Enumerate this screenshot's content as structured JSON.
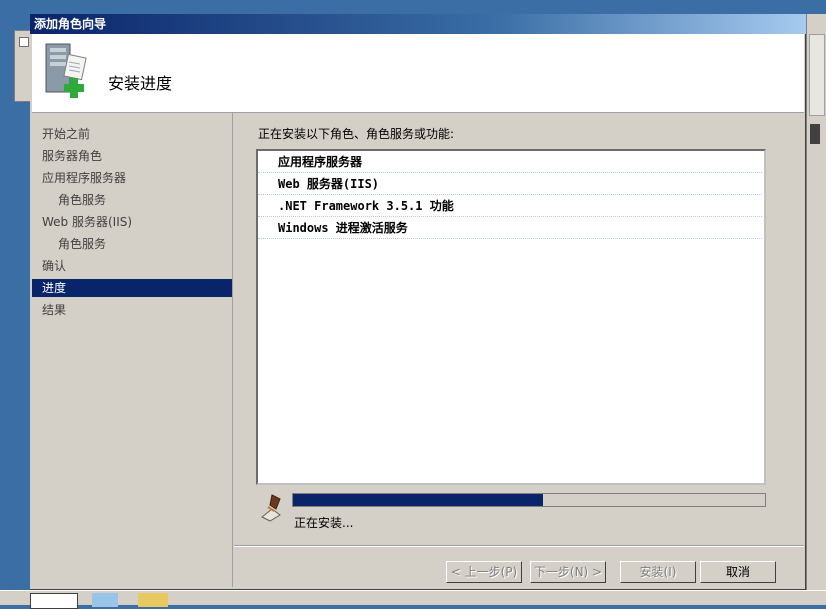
{
  "window": {
    "title": "添加角色向导"
  },
  "header": {
    "title": "安装进度",
    "icon": "server-add-icon"
  },
  "nav": {
    "items": [
      {
        "label": "开始之前",
        "sub": false,
        "active": false
      },
      {
        "label": "服务器角色",
        "sub": false,
        "active": false
      },
      {
        "label": "应用程序服务器",
        "sub": false,
        "active": false
      },
      {
        "label": "角色服务",
        "sub": true,
        "active": false
      },
      {
        "label": "Web 服务器(IIS)",
        "sub": false,
        "active": false
      },
      {
        "label": "角色服务",
        "sub": true,
        "active": false
      },
      {
        "label": "确认",
        "sub": false,
        "active": false
      },
      {
        "label": "进度",
        "sub": false,
        "active": true
      },
      {
        "label": "结果",
        "sub": false,
        "active": false
      }
    ]
  },
  "main": {
    "label": "正在安装以下角色、角色服务或功能:",
    "items": [
      "应用程序服务器",
      "Web 服务器(IIS)",
      ".NET Framework 3.5.1 功能",
      "Windows 进程激活服务"
    ],
    "progress_fraction": 0.53,
    "status_text": "正在安装..."
  },
  "buttons": {
    "back": "< 上一步(P)",
    "next": "下一步(N) >",
    "install": "安装(I)",
    "cancel": "取消"
  },
  "colors": {
    "titlebar": "#0a246a",
    "selection": "#0a246a",
    "progress": "#0a246a"
  }
}
